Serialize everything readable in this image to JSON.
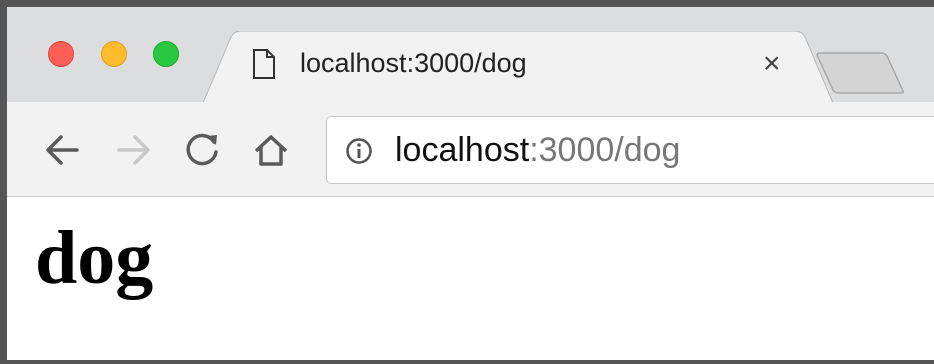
{
  "tab": {
    "title": "localhost:3000/dog",
    "close_symbol": "×"
  },
  "omnibox": {
    "host": "localhost",
    "rest": ":3000/dog"
  },
  "page": {
    "heading": "dog"
  },
  "icons": {
    "window_close": "red-traffic-light",
    "window_minimize": "yellow-traffic-light",
    "window_maximize": "green-traffic-light",
    "tab_favicon": "document-icon",
    "back": "arrow-left-icon",
    "forward": "arrow-right-icon",
    "reload": "reload-icon",
    "home": "home-icon",
    "site_info": "info-icon"
  },
  "colors": {
    "close": "#ff5f57",
    "minimize": "#ffbd2e",
    "maximize": "#28c940"
  }
}
